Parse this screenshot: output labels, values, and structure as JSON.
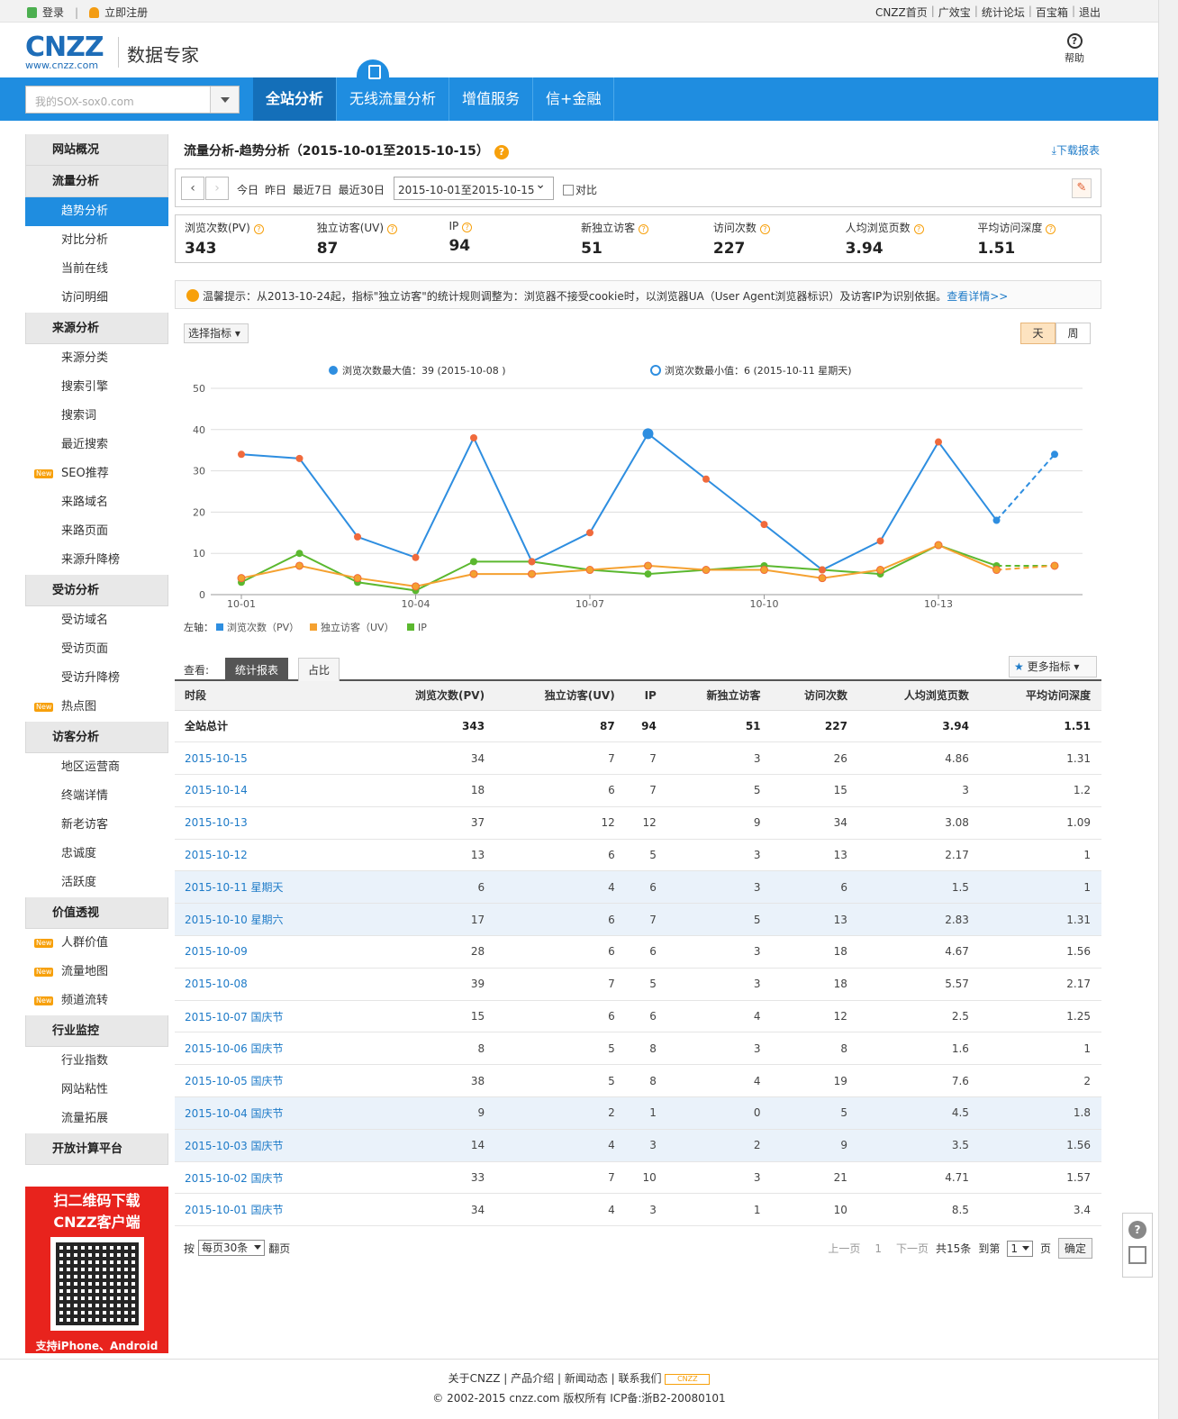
{
  "topbar": {
    "login": "登录",
    "register": "立即注册",
    "links": [
      "CNZZ首页",
      "广效宝",
      "统计论坛",
      "百宝箱",
      "退出"
    ]
  },
  "header": {
    "logo": "CNZZ",
    "logo_url": "www.cnzz.com",
    "title": "数据专家",
    "help": "帮助"
  },
  "nav": {
    "site_placeholder": "我的SOX-sox0.com",
    "items": [
      "全站分析",
      "无线流量分析",
      "增值服务",
      "信+金融"
    ]
  },
  "sidebar": [
    {
      "type": "head",
      "label": "网站概况"
    },
    {
      "type": "head",
      "label": "流量分析"
    },
    {
      "type": "item",
      "label": "趋势分析",
      "active": true
    },
    {
      "type": "item",
      "label": "对比分析"
    },
    {
      "type": "item",
      "label": "当前在线"
    },
    {
      "type": "item",
      "label": "访问明细"
    },
    {
      "type": "head",
      "label": "来源分析"
    },
    {
      "type": "item",
      "label": "来源分类"
    },
    {
      "type": "item",
      "label": "搜索引擎"
    },
    {
      "type": "item",
      "label": "搜索词"
    },
    {
      "type": "item",
      "label": "最近搜索"
    },
    {
      "type": "item",
      "label": "SEO推荐",
      "new": true
    },
    {
      "type": "item",
      "label": "来路域名"
    },
    {
      "type": "item",
      "label": "来路页面"
    },
    {
      "type": "item",
      "label": "来源升降榜"
    },
    {
      "type": "head",
      "label": "受访分析"
    },
    {
      "type": "item",
      "label": "受访域名"
    },
    {
      "type": "item",
      "label": "受访页面"
    },
    {
      "type": "item",
      "label": "受访升降榜"
    },
    {
      "type": "item",
      "label": "热点图",
      "new": true
    },
    {
      "type": "head",
      "label": "访客分析"
    },
    {
      "type": "item",
      "label": "地区运营商"
    },
    {
      "type": "item",
      "label": "终端详情"
    },
    {
      "type": "item",
      "label": "新老访客"
    },
    {
      "type": "item",
      "label": "忠诚度"
    },
    {
      "type": "item",
      "label": "活跃度"
    },
    {
      "type": "head",
      "label": "价值透视"
    },
    {
      "type": "item",
      "label": "人群价值",
      "new": true
    },
    {
      "type": "item",
      "label": "流量地图",
      "new": true
    },
    {
      "type": "item",
      "label": "频道流转",
      "new": true
    },
    {
      "type": "head",
      "label": "行业监控"
    },
    {
      "type": "item",
      "label": "行业指数"
    },
    {
      "type": "item",
      "label": "网站粘性"
    },
    {
      "type": "item",
      "label": "流量拓展"
    },
    {
      "type": "head",
      "label": "开放计算平台"
    }
  ],
  "new_badge": "New",
  "ad": {
    "line1": "扫二维码下载",
    "line2": "CNZZ客户端",
    "line3": "支持iPhone、Android"
  },
  "main": {
    "title": "流量分析-趋势分析（2015-10-01至2015-10-15）",
    "download": "下载报表",
    "quick": [
      "今日",
      "昨日",
      "最近7日",
      "最近30日"
    ],
    "date_range": "2015-10-01至2015-10-15",
    "compare": "对比",
    "metrics": [
      {
        "label": "浏览次数(PV)",
        "value": "343"
      },
      {
        "label": "独立访客(UV)",
        "value": "87"
      },
      {
        "label": "IP",
        "value": "94"
      },
      {
        "label": "新独立访客",
        "value": "51"
      },
      {
        "label": "访问次数",
        "value": "227"
      },
      {
        "label": "人均浏览页数",
        "value": "3.94"
      },
      {
        "label": "平均访问深度",
        "value": "1.51"
      }
    ],
    "notice": "温馨提示：从2013-10-24起，指标\"独立访客\"的统计规则调整为：浏览器不接受cookie时，以浏览器UA（User Agent浏览器标识）及访客IP为识别依据。",
    "notice_link": "查看详情>>",
    "select_metric": "选择指标",
    "day": "天",
    "week": "周",
    "view_label": "查看:",
    "tab_report": "统计报表",
    "tab_ratio": "占比",
    "more_metrics": "更多指标",
    "pager": {
      "per_page_prefix": "按",
      "per_page": "每页30条",
      "per_page_suffix": "翻页",
      "prev": "上一页",
      "page": "1",
      "next": "下一页",
      "total": "共15条",
      "goto": "到第",
      "goto_page": "1",
      "page_unit": "页",
      "confirm": "确定"
    }
  },
  "chart_data": {
    "type": "line",
    "max_label": "浏览次数最大值：39 (2015-10-08 )",
    "min_label": "浏览次数最小值：6 (2015-10-11 星期天)",
    "x_ticks": [
      "10-01",
      "10-04",
      "10-07",
      "10-10",
      "10-13"
    ],
    "y_ticks": [
      "0",
      "10",
      "20",
      "30",
      "40",
      "50"
    ],
    "ylim": [
      0,
      50
    ],
    "legend_prefix": "左轴：",
    "series": [
      {
        "name": "浏览次数（PV）",
        "color": "#2e8ee0",
        "values": [
          34,
          33,
          14,
          9,
          38,
          8,
          15,
          39,
          28,
          17,
          6,
          13,
          37,
          18,
          34
        ]
      },
      {
        "name": "独立访客（UV）",
        "color": "#f5a130",
        "values": [
          4,
          7,
          4,
          2,
          5,
          5,
          6,
          7,
          6,
          6,
          4,
          6,
          12,
          6,
          7
        ]
      },
      {
        "name": "IP",
        "color": "#5bb82f",
        "values": [
          3,
          10,
          3,
          1,
          8,
          8,
          6,
          5,
          6,
          7,
          6,
          5,
          12,
          7,
          7
        ]
      }
    ]
  },
  "table": {
    "headers": [
      "时段",
      "浏览次数(PV)",
      "独立访客(UV)",
      "IP",
      "新独立访客",
      "访问次数",
      "人均浏览页数",
      "平均访问深度"
    ],
    "total": [
      "全站总计",
      "343",
      "87",
      "94",
      "51",
      "227",
      "3.94",
      "1.51"
    ],
    "rows": [
      [
        "2015-10-15",
        "34",
        "7",
        "7",
        "3",
        "26",
        "4.86",
        "1.31"
      ],
      [
        "2015-10-14",
        "18",
        "6",
        "7",
        "5",
        "15",
        "3",
        "1.2"
      ],
      [
        "2015-10-13",
        "37",
        "12",
        "12",
        "9",
        "34",
        "3.08",
        "1.09"
      ],
      [
        "2015-10-12",
        "13",
        "6",
        "5",
        "3",
        "13",
        "2.17",
        "1"
      ],
      [
        "2015-10-11 星期天",
        "6",
        "4",
        "6",
        "3",
        "6",
        "1.5",
        "1"
      ],
      [
        "2015-10-10 星期六",
        "17",
        "6",
        "7",
        "5",
        "13",
        "2.83",
        "1.31"
      ],
      [
        "2015-10-09",
        "28",
        "6",
        "6",
        "3",
        "18",
        "4.67",
        "1.56"
      ],
      [
        "2015-10-08",
        "39",
        "7",
        "5",
        "3",
        "18",
        "5.57",
        "2.17"
      ],
      [
        "2015-10-07 国庆节",
        "15",
        "6",
        "6",
        "4",
        "12",
        "2.5",
        "1.25"
      ],
      [
        "2015-10-06 国庆节",
        "8",
        "5",
        "8",
        "3",
        "8",
        "1.6",
        "1"
      ],
      [
        "2015-10-05 国庆节",
        "38",
        "5",
        "8",
        "4",
        "19",
        "7.6",
        "2"
      ],
      [
        "2015-10-04 国庆节",
        "9",
        "2",
        "1",
        "0",
        "5",
        "4.5",
        "1.8"
      ],
      [
        "2015-10-03 国庆节",
        "14",
        "4",
        "3",
        "2",
        "9",
        "3.5",
        "1.56"
      ],
      [
        "2015-10-02 国庆节",
        "33",
        "7",
        "10",
        "3",
        "21",
        "4.71",
        "1.57"
      ],
      [
        "2015-10-01 国庆节",
        "34",
        "4",
        "3",
        "1",
        "10",
        "8.5",
        "3.4"
      ]
    ]
  },
  "footer": {
    "links": "关于CNZZ | 产品介绍 | 新闻动态 | 联系我们",
    "badge": "CNZZ",
    "copyright": "© 2002-2015 cnzz.com 版权所有 ICP备:浙B2-20080101"
  }
}
